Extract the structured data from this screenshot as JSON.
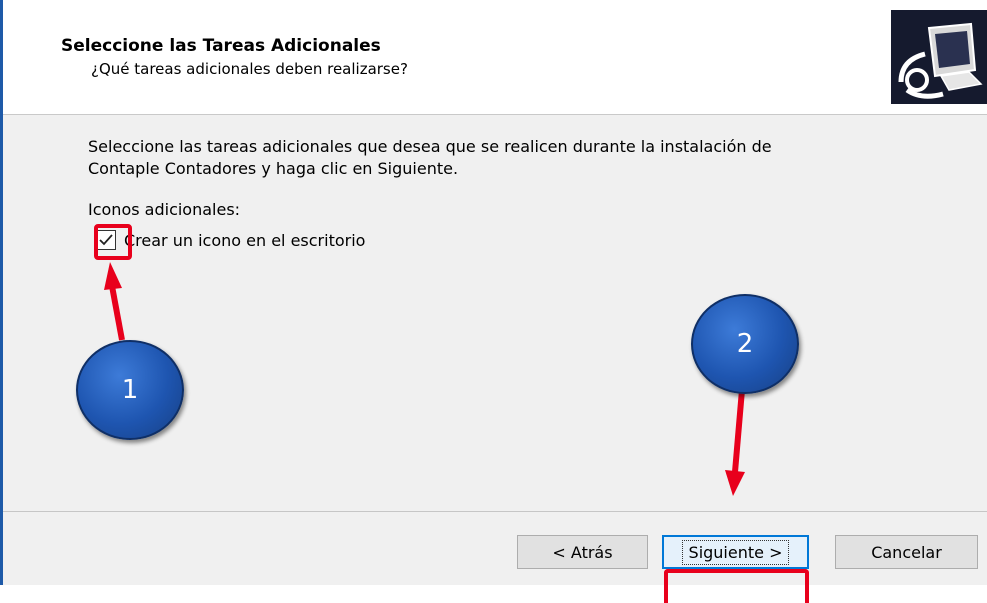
{
  "header": {
    "title": "Seleccione las Tareas Adicionales",
    "subtitle": "¿Qué tareas adicionales deben realizarse?"
  },
  "body": {
    "description_line1": "Seleccione las tareas adicionales que desea que se realicen durante la instalación de",
    "description_line2": "Contaple Contadores y haga clic en Siguiente.",
    "group_label": "Iconos adicionales:",
    "checkbox": {
      "label": "Crear un icono en el escritorio",
      "checked": true
    }
  },
  "buttons": {
    "back": "< Atrás",
    "next": "Siguiente >",
    "cancel": "Cancelar"
  },
  "annotations": {
    "step1": "1",
    "step2": "2",
    "highlight_color": "#e8001c",
    "bubble_color": "#1e55b0"
  }
}
